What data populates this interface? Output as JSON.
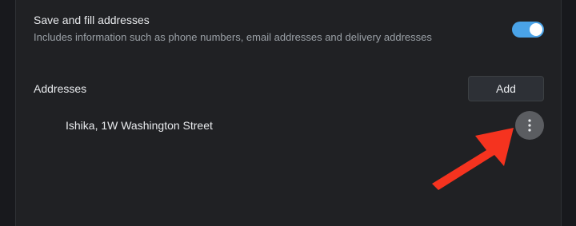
{
  "autofill": {
    "title": "Save and fill addresses",
    "subtitle": "Includes information such as phone numbers, email addresses and delivery addresses",
    "toggle_state": "on"
  },
  "addresses": {
    "section_title": "Addresses",
    "add_label": "Add",
    "entries": [
      {
        "label": "Ishika, 1W Washington Street"
      }
    ]
  },
  "icons": {
    "more": "more-vert-icon",
    "annotation": "red-arrow-annotation"
  },
  "colors": {
    "background": "#18191d",
    "panel": "#202124",
    "toggle_on": "#4aa3e8",
    "arrow": "#f5331f"
  }
}
